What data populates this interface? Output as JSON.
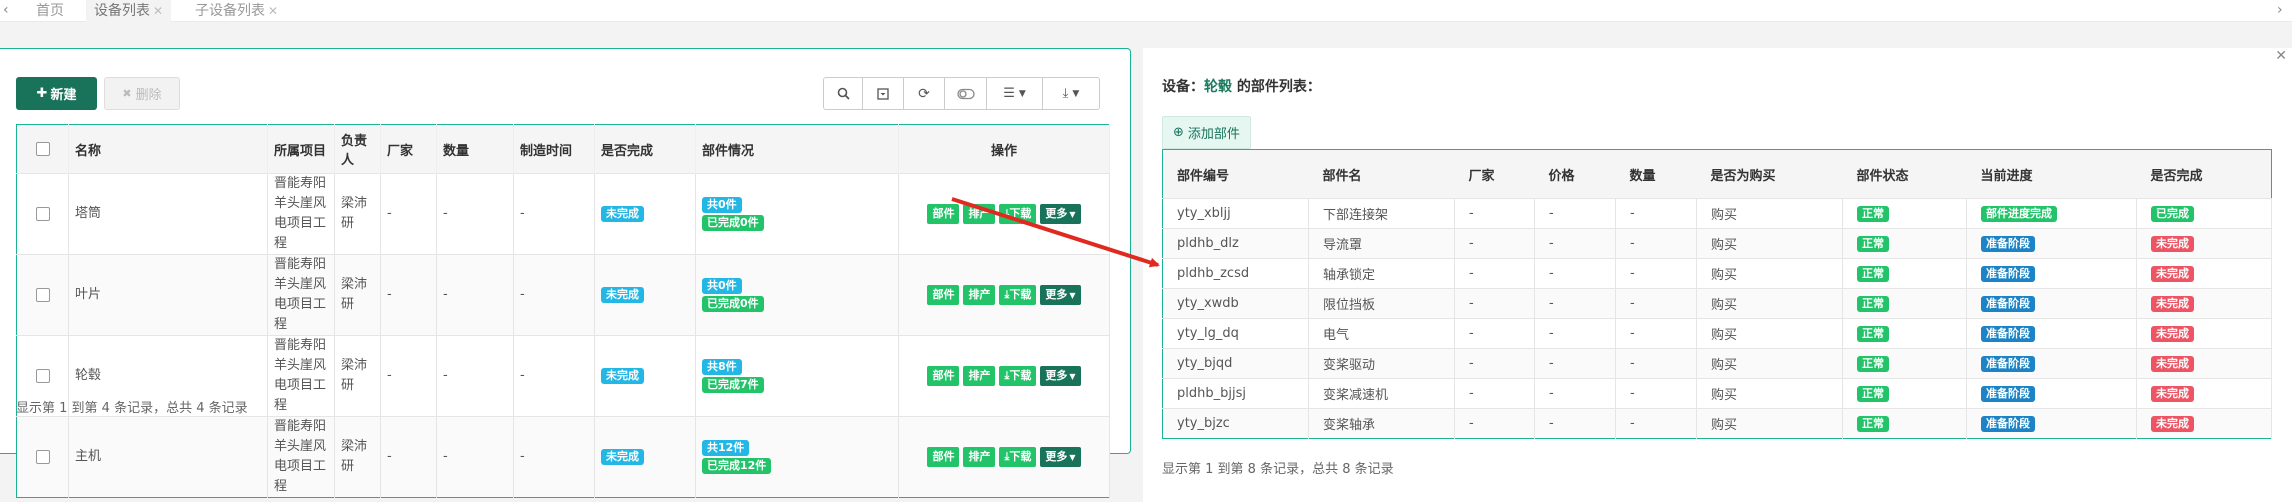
{
  "tabs": [
    {
      "label": "首页",
      "closable": false
    },
    {
      "label": "设备列表",
      "closable": true
    },
    {
      "label": "子设备列表",
      "closable": true
    }
  ],
  "left": {
    "new_label": "新建",
    "delete_label": "删除",
    "columns": [
      "名称",
      "所属项目",
      "负责人",
      "厂家",
      "数量",
      "制造时间",
      "是否完成",
      "部件情况",
      "操作"
    ],
    "rows": [
      {
        "name": "塔筒",
        "project": "晋能寿阳羊头崖风电项目工程",
        "owner": "梁沛研",
        "maker": "-",
        "qty": "-",
        "made": "-",
        "done": "未完成",
        "parts_total": "共0件",
        "parts_done": "已完成0件"
      },
      {
        "name": "叶片",
        "project": "晋能寿阳羊头崖风电项目工程",
        "owner": "梁沛研",
        "maker": "-",
        "qty": "-",
        "made": "-",
        "done": "未完成",
        "parts_total": "共0件",
        "parts_done": "已完成0件"
      },
      {
        "name": "轮毂",
        "project": "晋能寿阳羊头崖风电项目工程",
        "owner": "梁沛研",
        "maker": "-",
        "qty": "-",
        "made": "-",
        "done": "未完成",
        "parts_total": "共8件",
        "parts_done": "已完成7件"
      },
      {
        "name": "主机",
        "project": "晋能寿阳羊头崖风电项目工程",
        "owner": "梁沛研",
        "maker": "-",
        "qty": "-",
        "made": "-",
        "done": "未完成",
        "parts_total": "共12件",
        "parts_done": "已完成12件"
      }
    ],
    "ops": {
      "parts": "部件",
      "schedule": "排产",
      "download": "下载",
      "more": "更多"
    },
    "footer": "显示第 1 到第 4 条记录，总共 4 条记录"
  },
  "right": {
    "title_prefix": "设备：",
    "title_name": "轮毂",
    "title_suffix": " 的部件列表：",
    "add_label": "添加部件",
    "columns": [
      "部件编号",
      "部件名",
      "厂家",
      "价格",
      "数量",
      "是否为购买",
      "部件状态",
      "当前进度",
      "是否完成"
    ],
    "rows": [
      {
        "code": "yty_xbljj",
        "name": "下部连接架",
        "maker": "-",
        "price": "-",
        "qty": "-",
        "buy": "购买",
        "status": "正常",
        "progress": "部件进度完成",
        "done": "已完成"
      },
      {
        "code": "pldhb_dlz",
        "name": "导流罩",
        "maker": "-",
        "price": "-",
        "qty": "-",
        "buy": "购买",
        "status": "正常",
        "progress": "准备阶段",
        "done": "未完成"
      },
      {
        "code": "pldhb_zcsd",
        "name": "轴承锁定",
        "maker": "-",
        "price": "-",
        "qty": "-",
        "buy": "购买",
        "status": "正常",
        "progress": "准备阶段",
        "done": "未完成"
      },
      {
        "code": "yty_xwdb",
        "name": "限位挡板",
        "maker": "-",
        "price": "-",
        "qty": "-",
        "buy": "购买",
        "status": "正常",
        "progress": "准备阶段",
        "done": "未完成"
      },
      {
        "code": "yty_lg_dq",
        "name": "电气",
        "maker": "-",
        "price": "-",
        "qty": "-",
        "buy": "购买",
        "status": "正常",
        "progress": "准备阶段",
        "done": "未完成"
      },
      {
        "code": "yty_bjqd",
        "name": "变桨驱动",
        "maker": "-",
        "price": "-",
        "qty": "-",
        "buy": "购买",
        "status": "正常",
        "progress": "准备阶段",
        "done": "未完成"
      },
      {
        "code": "pldhb_bjjsj",
        "name": "变桨减速机",
        "maker": "-",
        "price": "-",
        "qty": "-",
        "buy": "购买",
        "status": "正常",
        "progress": "准备阶段",
        "done": "未完成"
      },
      {
        "code": "yty_bjzc",
        "name": "变桨轴承",
        "maker": "-",
        "price": "-",
        "qty": "-",
        "buy": "购买",
        "status": "正常",
        "progress": "准备阶段",
        "done": "未完成"
      }
    ],
    "footer": "显示第 1 到第 8 条记录，总共 8 条记录"
  },
  "colors": {
    "accent": "#1ab394",
    "dark_green": "#18735a",
    "arrow": "#e02a1f",
    "badge_blue": "#23b7e5",
    "badge_green": "#23c36a",
    "badge_red": "#ed5565"
  }
}
